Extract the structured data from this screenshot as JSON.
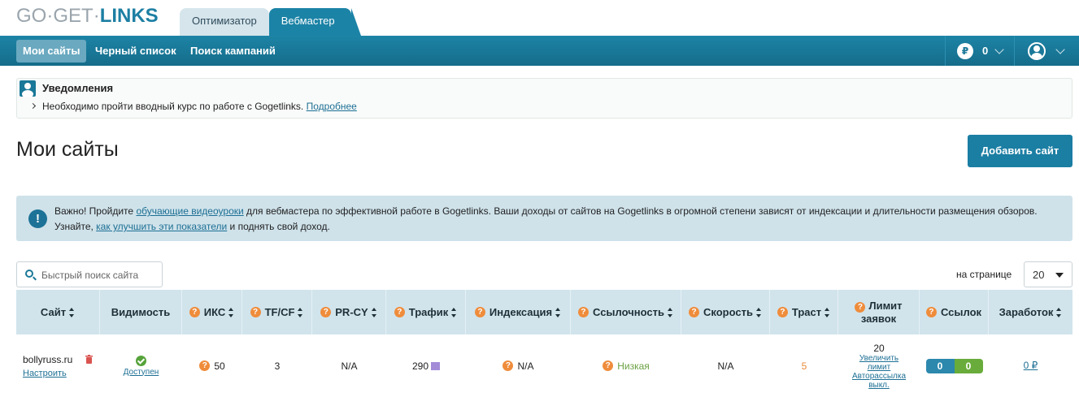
{
  "logo": {
    "part1": "GO",
    "part2": "GET",
    "part3": "LINKS"
  },
  "role_tabs": [
    {
      "label": "Оптимизатор"
    },
    {
      "label": "Вебмастер"
    }
  ],
  "nav": {
    "items": [
      {
        "label": "Мои сайты"
      },
      {
        "label": "Черный список"
      },
      {
        "label": "Поиск кампаний"
      }
    ],
    "balance_symbol": "₽",
    "balance": "0"
  },
  "notifications": {
    "title": "Уведомления",
    "text": "Необходимо пройти вводный курс по работе с Gogetlinks.",
    "link": "Подробнее"
  },
  "page_title": "Мои сайты",
  "add_button": "Добавить сайт",
  "info": {
    "icon": "!",
    "t1": "Важно! Пройдите ",
    "link1": "обучающие видеоуроки",
    "t2": " для вебмастера по эффективной работе в Gogetlinks. Ваши доходы от сайтов на Gogetlinks в огромной степени зависят от индексации и длительности размещения обзоров. Узнайте, ",
    "link2": "как улучшить эти показатели",
    "t3": " и поднять свой доход."
  },
  "search": {
    "placeholder": "Быстрый поиск сайта"
  },
  "per_page": {
    "label": "на странице",
    "value": "20"
  },
  "table": {
    "headers": {
      "site": "Сайт",
      "visibility": "Видимость",
      "iks": "ИКС",
      "tfcf": "TF/CF",
      "prcy": "PR-CY",
      "traffic": "Трафик",
      "indexing": "Индексация",
      "linkiness": "Ссылочность",
      "speed": "Скорость",
      "trust": "Траст",
      "limit": "Лимит заявок",
      "links": "Ссылок",
      "earnings": "Заработок"
    },
    "rows": [
      {
        "site": "bollyruss.ru",
        "configure": "Настроить",
        "visibility": "Доступен",
        "iks": "50",
        "tfcf": "3",
        "prcy": "N/A",
        "traffic": "290",
        "indexing": "N/A",
        "linkiness": "Низкая",
        "speed": "N/A",
        "trust": "5",
        "limit": "20",
        "limit_link1": "Увеличить лимит",
        "limit_link2": "Авторассылка выкл.",
        "links_a": "0",
        "links_b": "0",
        "earnings": "0 ₽"
      }
    ]
  },
  "colors": {
    "brand": "#1b7ea3",
    "nav": "#1a7898",
    "accent_orange": "#ef8c3b",
    "success_green": "#55a33a",
    "low_green": "#6aa142",
    "trust_orange": "#e98a3a"
  }
}
